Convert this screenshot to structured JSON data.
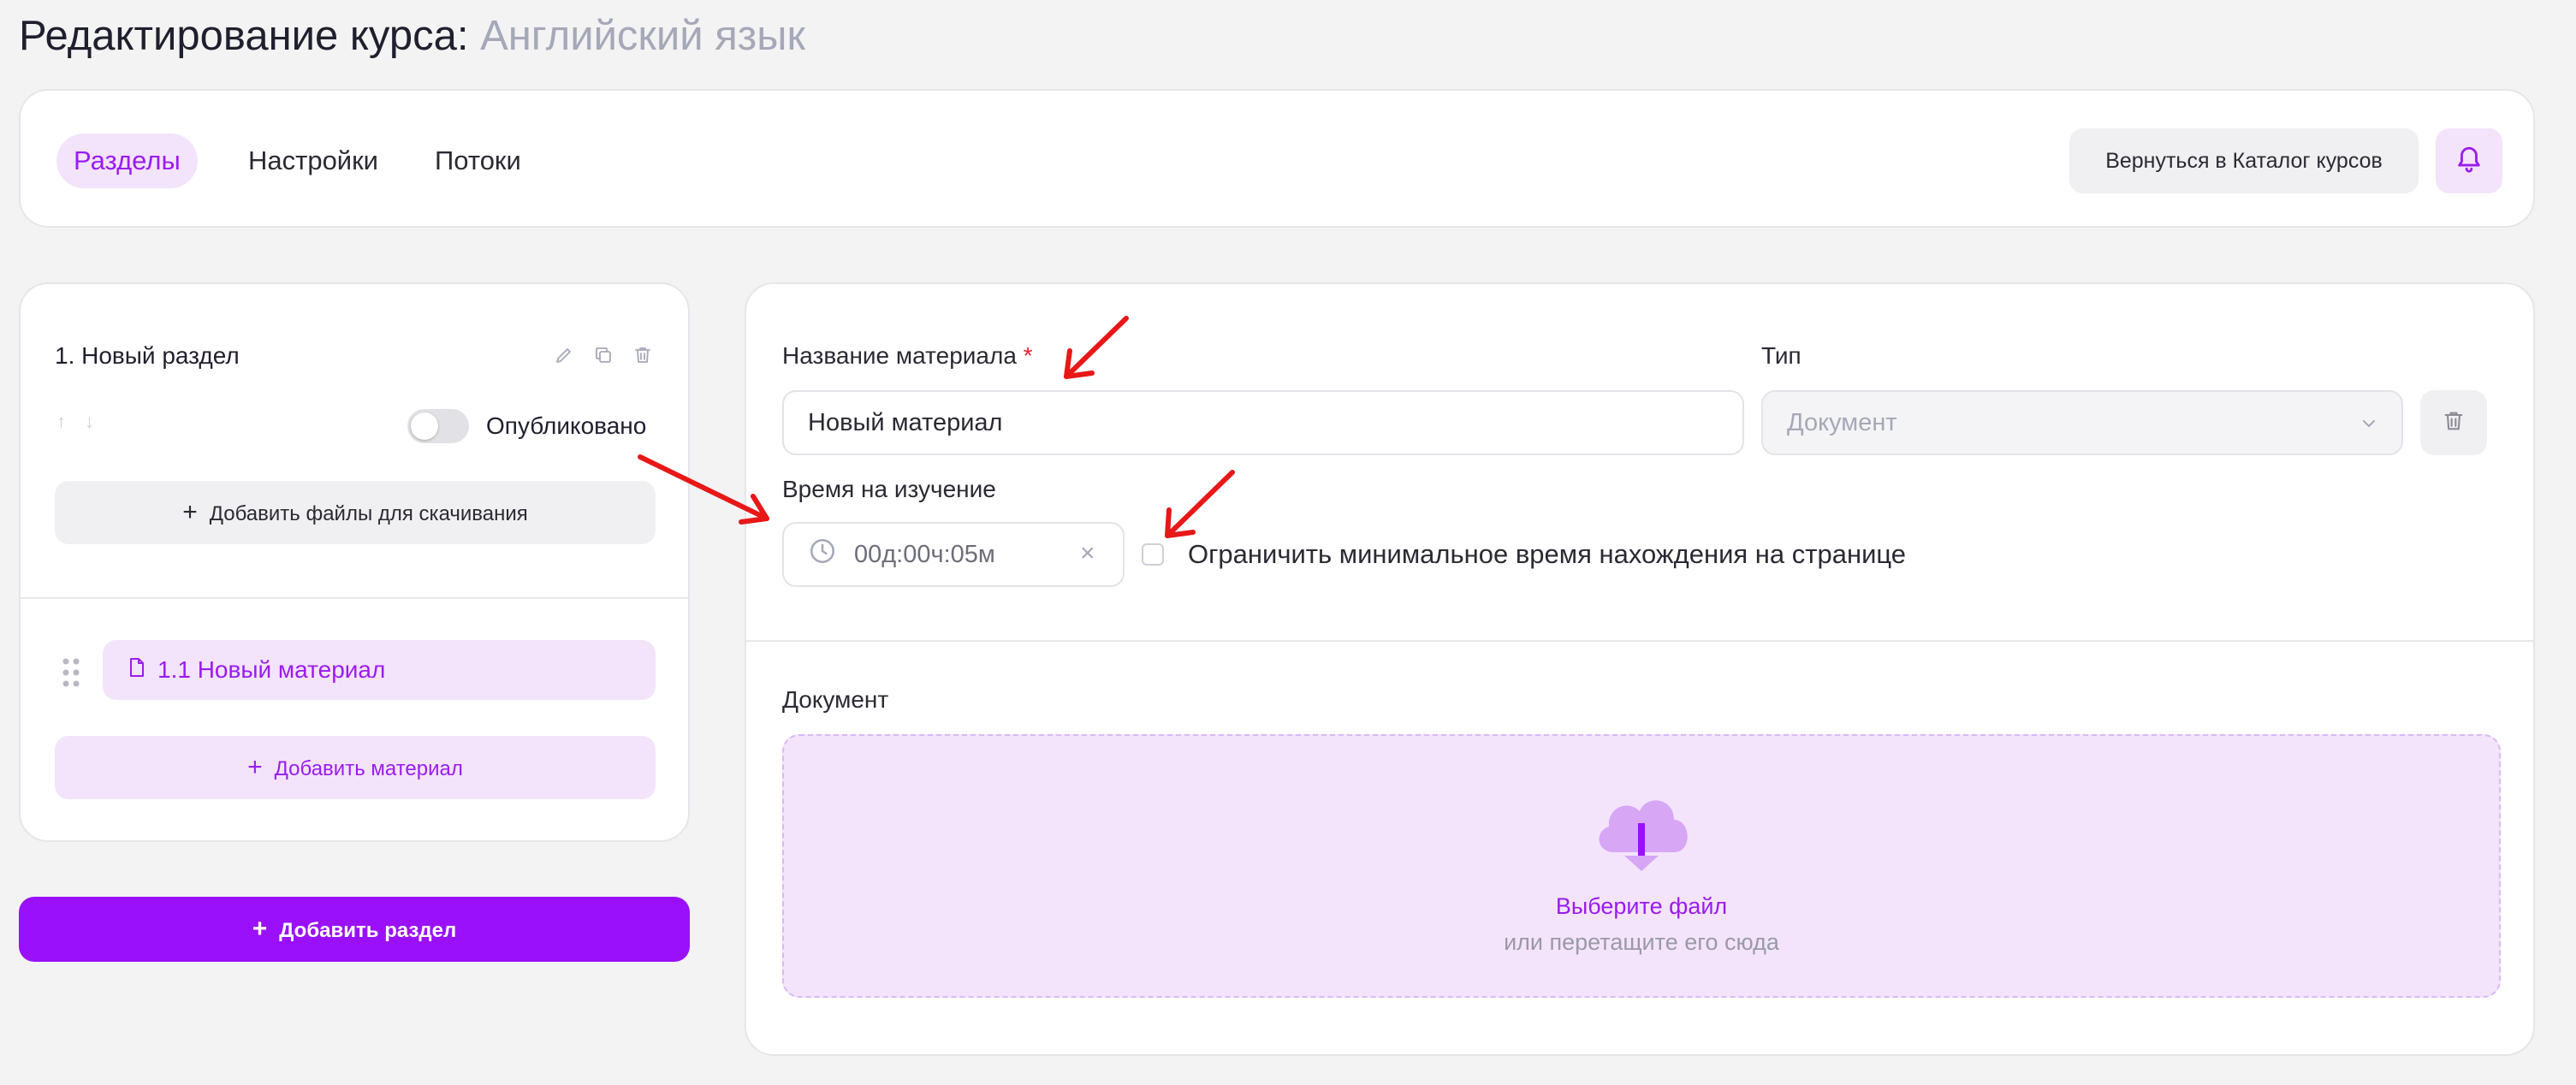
{
  "header": {
    "title_prefix": "Редактирование курса:",
    "course_name": "Английский язык"
  },
  "nav": {
    "tabs": [
      {
        "label": "Разделы",
        "active": true
      },
      {
        "label": "Настройки",
        "active": false
      },
      {
        "label": "Потоки",
        "active": false
      }
    ],
    "back_label": "Вернуться в Каталог курсов",
    "bell_icon": "bell-icon"
  },
  "sidebar": {
    "section_title": "1. Новый раздел",
    "section_icons": [
      "pencil-icon",
      "copy-icon",
      "trash-icon"
    ],
    "published_label": "Опубликовано",
    "published": false,
    "add_files_label": "Добавить файлы для скачивания",
    "material_label": "1.1 Новый материал",
    "add_material_label": "Добавить материал",
    "add_section_label": "Добавить раздел"
  },
  "form": {
    "name_label": "Название материала",
    "required_mark": "*",
    "name_value": "Новый материал",
    "type_label": "Тип",
    "type_value": "Документ",
    "time_label": "Время на изучение",
    "time_value": "00д:00ч:05м",
    "limit_label": "Ограничить минимальное время нахождения на странице",
    "limit_checked": false,
    "document_label": "Документ",
    "dropzone_title": "Выберите файл",
    "dropzone_subtitle": "или перетащите его сюда"
  },
  "colors": {
    "accent": "#9b10fa",
    "accent_soft": "#f3e4fb",
    "annotation_arrow": "#e81818"
  }
}
